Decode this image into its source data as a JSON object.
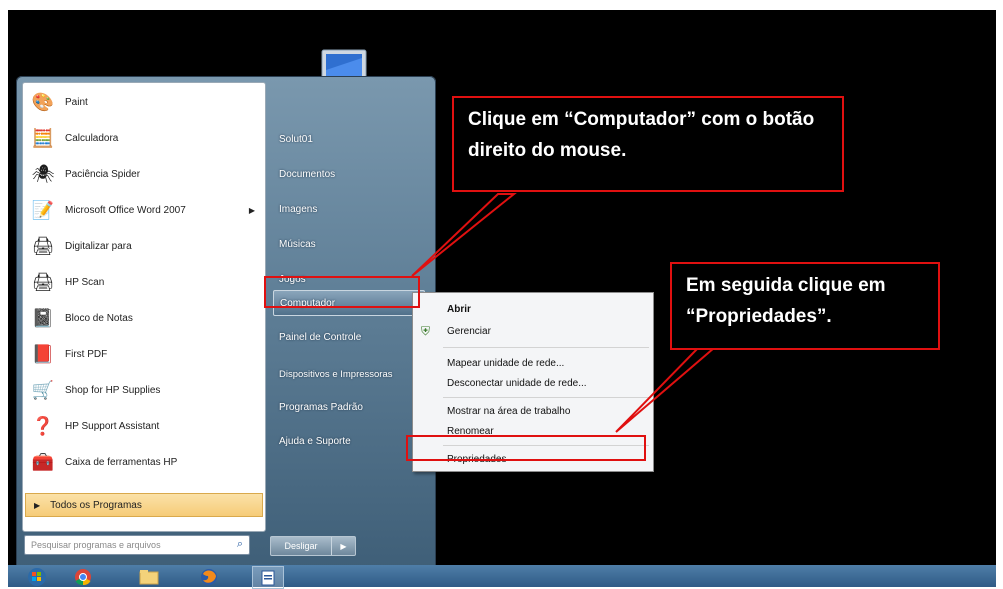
{
  "start_menu": {
    "programs": [
      {
        "label": "Paint",
        "icon": "paint-icon",
        "glyph": "🎨"
      },
      {
        "label": "Calculadora",
        "icon": "calculator-icon",
        "glyph": "🧮"
      },
      {
        "label": "Paciência Spider",
        "icon": "spider-icon",
        "glyph": "🕷"
      },
      {
        "label": "Microsoft Office Word 2007",
        "icon": "word-icon",
        "glyph": "📝",
        "has_submenu": true
      },
      {
        "label": "Digitalizar para",
        "icon": "scanner-icon",
        "glyph": "🖨"
      },
      {
        "label": "HP Scan",
        "icon": "hp-scan-icon",
        "glyph": "🖨"
      },
      {
        "label": "Bloco de Notas",
        "icon": "notepad-icon",
        "glyph": "📓"
      },
      {
        "label": "First PDF",
        "icon": "pdf-icon",
        "glyph": "📕"
      },
      {
        "label": "Shop for HP Supplies",
        "icon": "shop-icon",
        "glyph": "🛒"
      },
      {
        "label": "HP Support Assistant",
        "icon": "support-icon",
        "glyph": "❓"
      },
      {
        "label": "Caixa de ferramentas HP",
        "icon": "toolbox-icon",
        "glyph": "🧰"
      }
    ],
    "all_programs": "Todos os Programas",
    "search_placeholder": "Pesquisar programas e arquivos",
    "right_items": [
      "Solut01",
      "Documentos",
      "Imagens",
      "Músicas",
      "Jogos",
      "Computador",
      "Painel de Controle",
      "Dispositivos e Impressoras",
      "Programas Padrão",
      "Ajuda e Suporte"
    ],
    "highlighted_item": "Computador",
    "shutdown_label": "Desligar"
  },
  "context_menu": {
    "items": [
      "Abrir",
      "Gerenciar",
      "Mapear unidade de rede...",
      "Desconectar unidade de rede...",
      "Mostrar na área de trabalho",
      "Renomear",
      "Propriedades"
    ],
    "bold_item": "Abrir"
  },
  "annotations": {
    "callout1": "Clique em “Computador” com o botão direito do mouse.",
    "callout2": "Em seguida clique em “Propriedades”."
  },
  "colors": {
    "annotation": "#e01010",
    "desktop": "#000000"
  }
}
